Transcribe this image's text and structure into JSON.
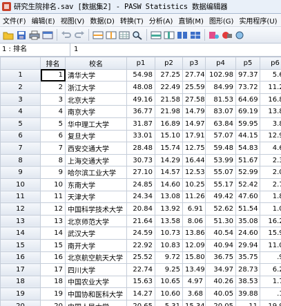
{
  "window": {
    "title": "研究生院排名.sav [数据集2] - PASW Statistics 数据编辑器"
  },
  "menu": [
    "文件(F)",
    "编辑(E)",
    "视图(V)",
    "数据(D)",
    "转换(T)",
    "分析(A)",
    "直销(M)",
    "图形(G)",
    "实用程序(U)",
    "窗"
  ],
  "toolbar": {
    "icons": [
      "open-folder",
      "save-disk",
      "print",
      "dialog-recall",
      "undo",
      "redo",
      "goto-case",
      "goto-variable",
      "variables",
      "find",
      "insert-cases",
      "insert-variable",
      "split-file",
      "weight-cases",
      "select-cases",
      "value-labels",
      "use-sets"
    ]
  },
  "cell_editor": {
    "ref": "1 : 排名",
    "value": "1"
  },
  "grid": {
    "columns": [
      "",
      "排名",
      "校名",
      "p1",
      "p2",
      "p3",
      "p4",
      "p5",
      "p6"
    ],
    "rows": [
      [
        "1",
        "1",
        "清华大学",
        "54.98",
        "27.25",
        "27.74",
        "102.98",
        "97.37",
        "5.61"
      ],
      [
        "2",
        "2",
        "浙江大学",
        "48.08",
        "22.49",
        "25.59",
        "84.99",
        "73.72",
        "11.27"
      ],
      [
        "3",
        "3",
        "北京大学",
        "49.16",
        "21.58",
        "27.58",
        "81.53",
        "64.69",
        "16.84"
      ],
      [
        "4",
        "4",
        "南京大学",
        "36.77",
        "21.98",
        "14.79",
        "83.07",
        "69.19",
        "13.88"
      ],
      [
        "5",
        "5",
        "华中理工大学",
        "31.87",
        "16.89",
        "14.97",
        "63.84",
        "59.95",
        "3.89"
      ],
      [
        "6",
        "6",
        "复旦大学",
        "33.01",
        "15.10",
        "17.91",
        "57.07",
        "44.15",
        "12.93"
      ],
      [
        "7",
        "7",
        "西安交通大学",
        "28.48",
        "15.74",
        "12.75",
        "59.48",
        "54.83",
        "4.64"
      ],
      [
        "8",
        "8",
        "上海交通大学",
        "30.73",
        "14.29",
        "16.44",
        "53.99",
        "51.67",
        "2.32"
      ],
      [
        "9",
        "9",
        "哈尔滨工业大学",
        "27.10",
        "14.57",
        "12.53",
        "55.07",
        "52.99",
        "2.09"
      ],
      [
        "10",
        "10",
        "东南大学",
        "24.85",
        "14.60",
        "10.25",
        "55.17",
        "52.42",
        "2.75"
      ],
      [
        "11",
        "11",
        "天津大学",
        "24.34",
        "13.08",
        "11.26",
        "49.42",
        "47.60",
        "1.82"
      ],
      [
        "12",
        "12",
        "中国科学技术大学",
        "20.84",
        "13.92",
        "6.91",
        "52.62",
        "51.54",
        "1.08"
      ],
      [
        "13",
        "13",
        "北京师范大学",
        "21.64",
        "13.58",
        "8.06",
        "51.30",
        "35.08",
        "16.23"
      ],
      [
        "14",
        "14",
        "武汉大学",
        "24.59",
        "10.73",
        "13.86",
        "40.54",
        "24.60",
        "15.94"
      ],
      [
        "15",
        "15",
        "南开大学",
        "22.92",
        "10.83",
        "12.09",
        "40.94",
        "29.94",
        "11.00"
      ],
      [
        "16",
        "16",
        "北京航空航天大学",
        "25.52",
        "9.72",
        "15.80",
        "36.75",
        "35.75",
        ".99"
      ],
      [
        "17",
        "17",
        "四川大学",
        "22.74",
        "9.25",
        "13.49",
        "34.97",
        "28.73",
        "6.24"
      ],
      [
        "18",
        "18",
        "中国农业大学",
        "15.63",
        "10.65",
        "4.97",
        "40.26",
        "38.53",
        "1.73"
      ],
      [
        "19",
        "19",
        "中国协和医科大学",
        "14.27",
        "10.60",
        "3.68",
        "40.05",
        "39.88",
        ".17"
      ],
      [
        "20",
        "20",
        "中国人民大学",
        "20.65",
        "5.31",
        "15.34",
        "20.05",
        ".11",
        "19.94"
      ]
    ]
  }
}
